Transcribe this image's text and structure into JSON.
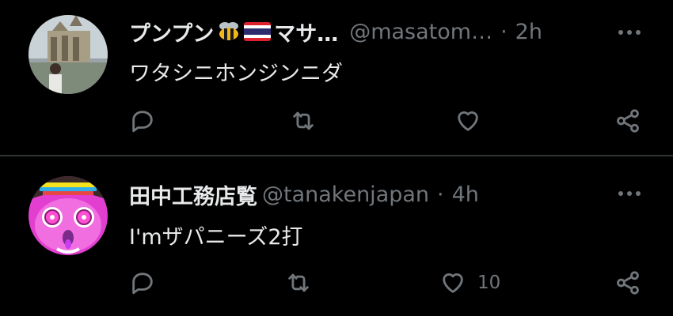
{
  "colors": {
    "background": "#000000",
    "text_primary": "#e7e9ea",
    "text_secondary": "#71767b",
    "divider": "#2f3336"
  },
  "posts": [
    {
      "display_name": "プンプン",
      "display_name_suffix": "マサ…",
      "name_emojis": [
        "bee-icon",
        "thai-flag-icon"
      ],
      "handle": "@masatom…",
      "separator": "·",
      "time": "2h",
      "text": "ワタシニホンジンニダ",
      "actions": {
        "reply_count": "",
        "repost_count": "",
        "like_count": ""
      }
    },
    {
      "display_name": "田中工務店",
      "name_badge": "覧",
      "handle": "@tanakenjapan",
      "separator": "·",
      "time": "4h",
      "text": "I'mザパニーズ2打",
      "actions": {
        "reply_count": "",
        "repost_count": "",
        "like_count": "10"
      }
    }
  ]
}
